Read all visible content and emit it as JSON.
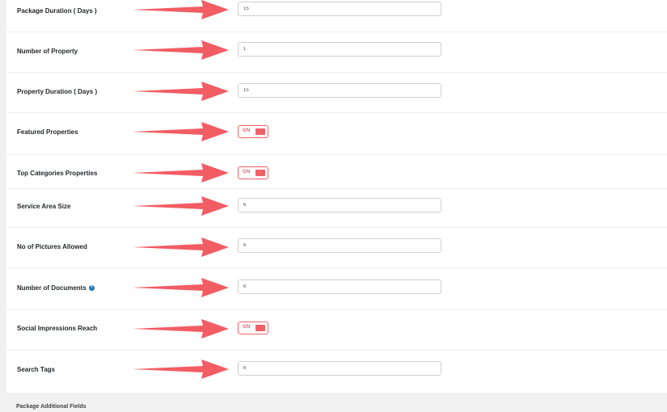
{
  "fields": [
    {
      "label": "Package Duration ( Days )",
      "type": "input",
      "value": "15"
    },
    {
      "label": "Number of Property",
      "type": "input",
      "value": "1"
    },
    {
      "label": "Property Duration ( Days )",
      "type": "input",
      "value": "15"
    },
    {
      "label": "Featured Properties",
      "type": "toggle",
      "toggle_label": "ON",
      "on": true
    },
    {
      "label": "Top Categories Properties",
      "type": "toggle",
      "toggle_label": "ON",
      "on": true
    },
    {
      "label": "Service Area Size",
      "type": "input",
      "value": "6"
    },
    {
      "label": "No of Pictures Allowed",
      "type": "input",
      "value": "6"
    },
    {
      "label": "Number of Documents",
      "type": "input",
      "value": "6",
      "help_icon": "help-icon"
    },
    {
      "label": "Social Impressions Reach",
      "type": "toggle",
      "toggle_label": "ON",
      "on": true
    },
    {
      "label": "Search Tags",
      "type": "input",
      "value": "6"
    }
  ],
  "section": {
    "title": "Package Additional Fields"
  },
  "colors": {
    "accent": "#f06166",
    "arrow": "#f25c63",
    "help": "#2271b1"
  },
  "help_glyph": "?"
}
